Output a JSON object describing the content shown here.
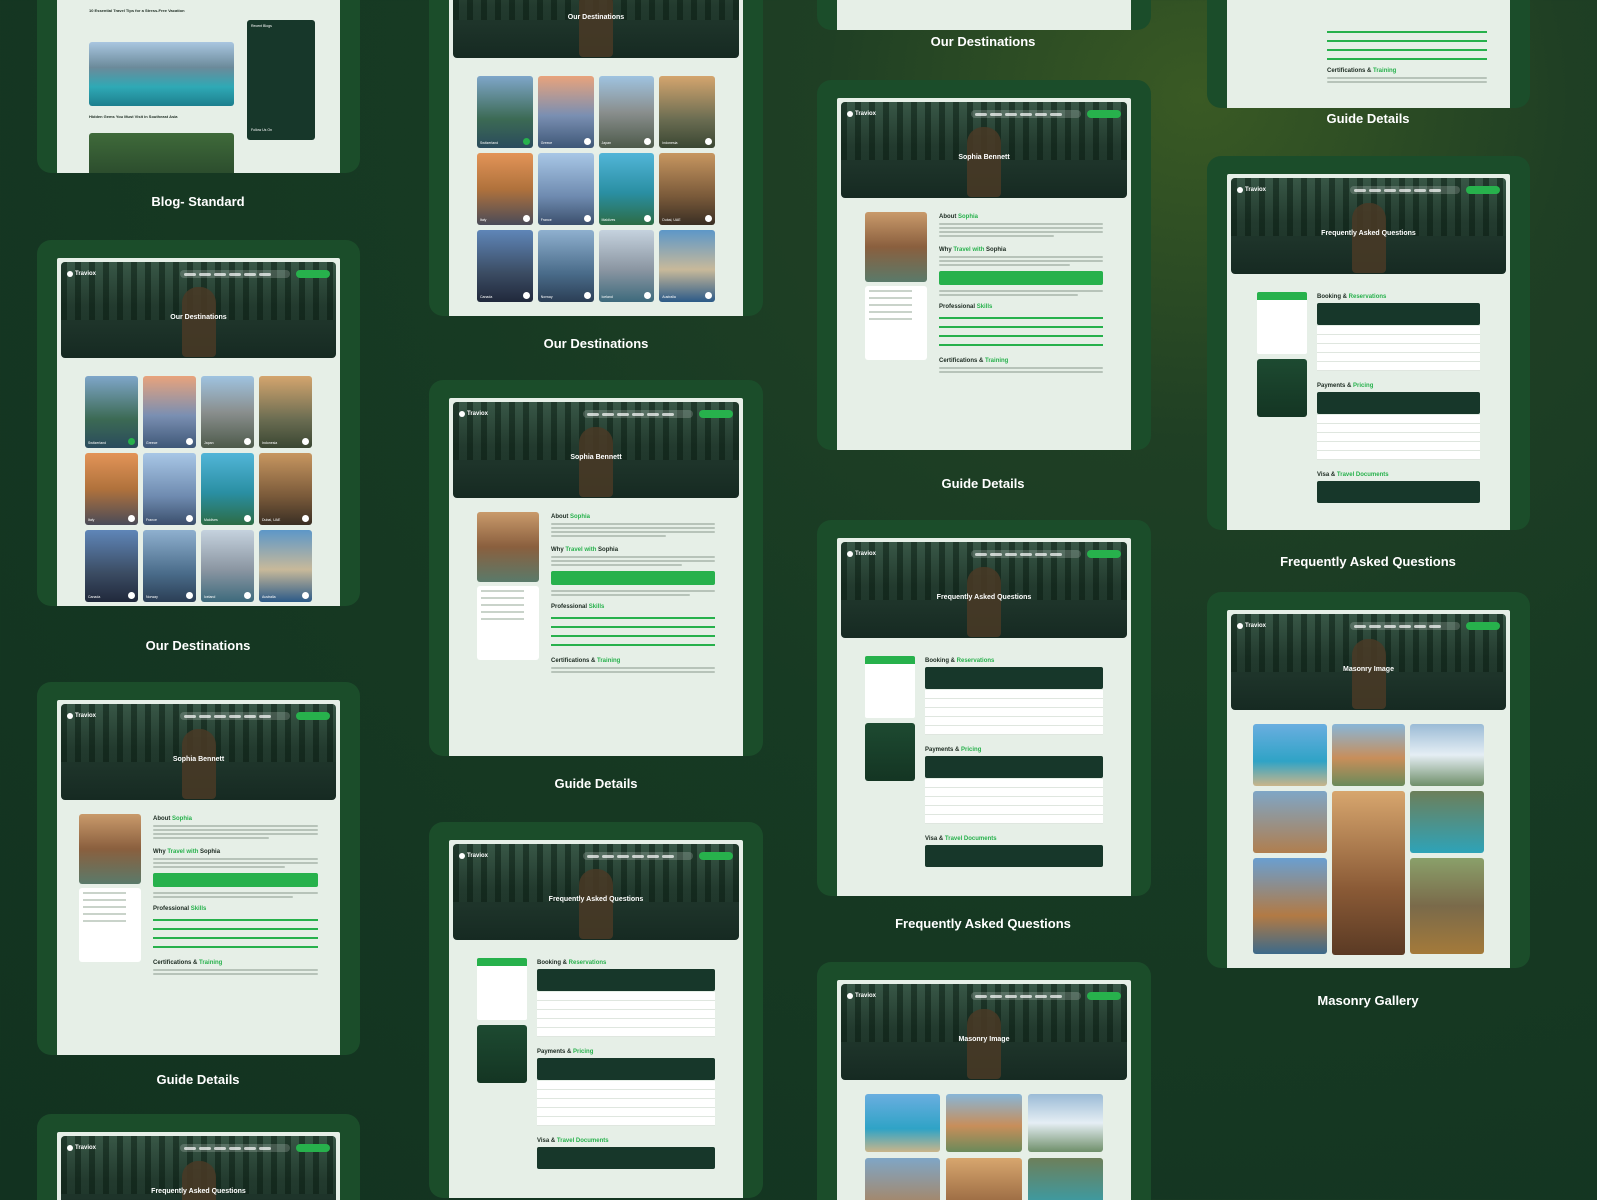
{
  "labels": {
    "blog_standard": "Blog- Standard",
    "our_destinations": "Our Destinations",
    "guide_details": "Guide Details",
    "faq": "Frequently Asked Questions",
    "masonry_gallery": "Masonry Gallery"
  },
  "hero_titles": {
    "destinations": "Our Destinations",
    "guide": "Sophia Bennett",
    "faq": "Frequently Asked Questions",
    "masonry": "Masonry Image"
  },
  "brand": "Traviox",
  "destinations": [
    "Switzerland",
    "Greece",
    "Japan",
    "Indonesia",
    "Italy",
    "France",
    "Maldives",
    "Dubai, UAE",
    "Canada",
    "Norway",
    "Iceland",
    "Australia"
  ],
  "guide": {
    "about_prefix": "About ",
    "about_name": "Sophia",
    "why_prefix": "Why ",
    "why_mid": "Travel with",
    "why_name": " Sophia",
    "skills_prefix": "Professional ",
    "skills_accent": "Skills",
    "cert_prefix": "Certifications & ",
    "cert_accent": "Training"
  },
  "faq": {
    "booking_prefix": "Booking & ",
    "booking_accent": "Reservations",
    "payments_prefix": "Payments & ",
    "payments_accent": "Pricing",
    "visa_prefix": "Visa & ",
    "visa_accent": "Travel Documents"
  },
  "blog": {
    "post1": "10 Essential Travel Tips for a Stress-Free Vacation",
    "post2": "Hidden Gems You Must Visit in Southeast Asia",
    "recent": "Recent Blogs",
    "follow": "Follow Us On"
  },
  "colors": {
    "accent": "#27b14c",
    "card": "#1b4d2a",
    "page": "#e6efe7"
  }
}
